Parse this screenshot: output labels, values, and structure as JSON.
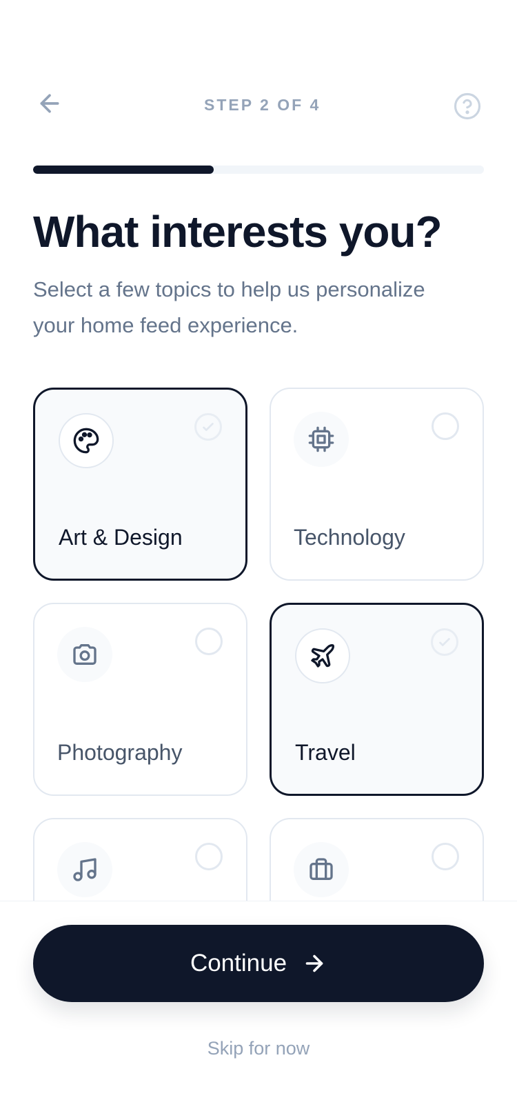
{
  "header": {
    "step_label": "STEP 2 OF 4",
    "progress": 0.4,
    "back_icon": "arrow-left-icon",
    "help_icon": "help-circle-icon"
  },
  "title": "What interests you?",
  "subtitle": "Select a few topics to help us personalize your home feed experience.",
  "topics": [
    {
      "label": "Art & Design",
      "icon": "palette-icon",
      "selected": true
    },
    {
      "label": "Technology",
      "icon": "cpu-chip-icon",
      "selected": false
    },
    {
      "label": "Photography",
      "icon": "camera-icon",
      "selected": false
    },
    {
      "label": "Travel",
      "icon": "airplane-icon",
      "selected": true
    },
    {
      "label": "",
      "icon": "music-note-icon",
      "selected": false
    },
    {
      "label": "",
      "icon": "briefcase-icon",
      "selected": false
    }
  ],
  "footer": {
    "continue_label": "Continue",
    "continue_icon": "arrow-right-icon",
    "skip_label": "Skip for now"
  },
  "colors": {
    "primary": "#0f172a",
    "muted": "#94a3b8",
    "text_secondary": "#64748b",
    "border": "#e2e8f0",
    "track": "#f1f5f9"
  }
}
